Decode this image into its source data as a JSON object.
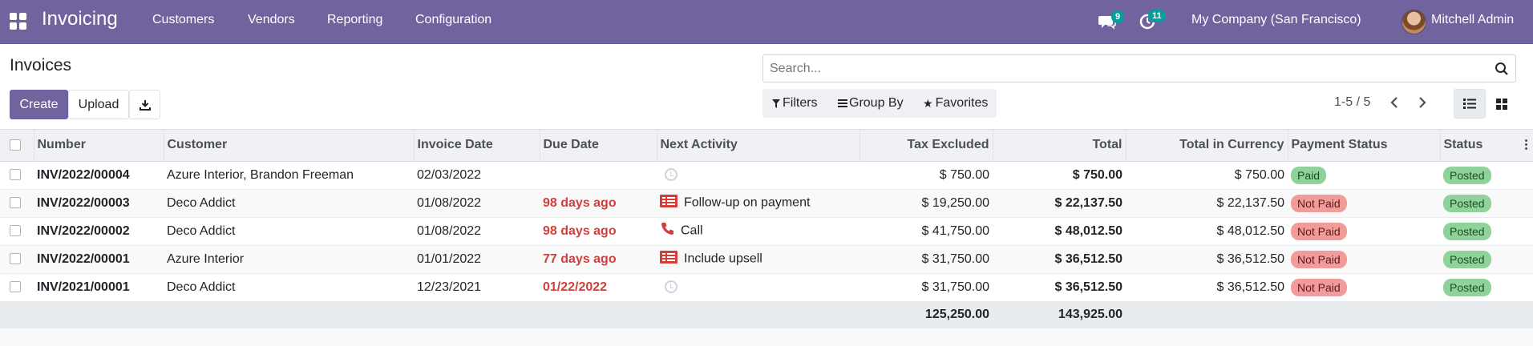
{
  "navbar": {
    "app_title": "Invoicing",
    "menu": [
      "Customers",
      "Vendors",
      "Reporting",
      "Configuration"
    ],
    "chat_count": "9",
    "activity_count": "11",
    "company": "My Company (San Francisco)",
    "user": "Mitchell Admin"
  },
  "control": {
    "title": "Invoices",
    "create_label": "Create",
    "upload_label": "Upload",
    "search_placeholder": "Search...",
    "filters_label": "Filters",
    "groupby_label": "Group By",
    "favorites_label": "Favorites",
    "pager": "1-5 / 5"
  },
  "table": {
    "headers": [
      "Number",
      "Customer",
      "Invoice Date",
      "Due Date",
      "Next Activity",
      "Tax Excluded",
      "Total",
      "Total in Currency",
      "Payment Status",
      "Status"
    ],
    "rows": [
      {
        "number": "INV/2022/00004",
        "customer": "Azure Interior, Brandon Freeman",
        "invoice_date": "02/03/2022",
        "due_date": "",
        "due_overdue": false,
        "activity": "",
        "activity_icon": "clock-icon",
        "tax_excluded": "$ 750.00",
        "total": "$ 750.00",
        "total_currency": "$ 750.00",
        "payment_status": "Paid",
        "status": "Posted"
      },
      {
        "number": "INV/2022/00003",
        "customer": "Deco Addict",
        "invoice_date": "01/08/2022",
        "due_date": "98 days ago",
        "due_overdue": true,
        "activity": "Follow-up on payment",
        "activity_icon": "task-icon",
        "tax_excluded": "$ 19,250.00",
        "total": "$ 22,137.50",
        "total_currency": "$ 22,137.50",
        "payment_status": "Not Paid",
        "status": "Posted"
      },
      {
        "number": "INV/2022/00002",
        "customer": "Deco Addict",
        "invoice_date": "01/08/2022",
        "due_date": "98 days ago",
        "due_overdue": true,
        "activity": "Call",
        "activity_icon": "phone-icon",
        "tax_excluded": "$ 41,750.00",
        "total": "$ 48,012.50",
        "total_currency": "$ 48,012.50",
        "payment_status": "Not Paid",
        "status": "Posted"
      },
      {
        "number": "INV/2022/00001",
        "customer": "Azure Interior",
        "invoice_date": "01/01/2022",
        "due_date": "77 days ago",
        "due_overdue": true,
        "activity": "Include upsell",
        "activity_icon": "task-icon",
        "tax_excluded": "$ 31,750.00",
        "total": "$ 36,512.50",
        "total_currency": "$ 36,512.50",
        "payment_status": "Not Paid",
        "status": "Posted"
      },
      {
        "number": "INV/2021/00001",
        "customer": "Deco Addict",
        "invoice_date": "12/23/2021",
        "due_date": "01/22/2022",
        "due_overdue": true,
        "activity": "",
        "activity_icon": "clock-icon",
        "tax_excluded": "$ 31,750.00",
        "total": "$ 36,512.50",
        "total_currency": "$ 36,512.50",
        "payment_status": "Not Paid",
        "status": "Posted"
      }
    ],
    "footer": {
      "tax_excluded": "125,250.00",
      "total": "143,925.00"
    }
  },
  "colors": {
    "brand": "#71639e",
    "overdue": "#d23f3a",
    "paid": "#8fd39a",
    "not_paid": "#f19b9b",
    "badge": "#00a09d"
  }
}
